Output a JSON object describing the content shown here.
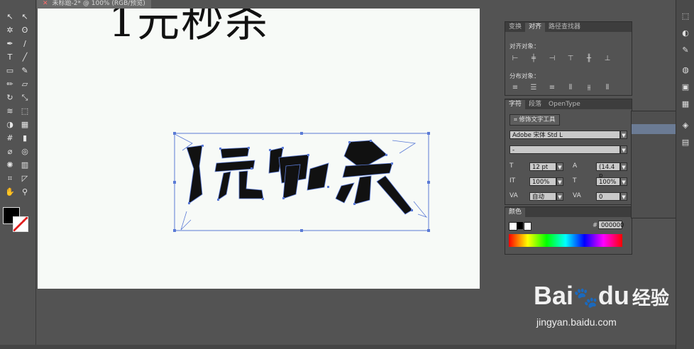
{
  "document": {
    "tab_title": "未标题-2* @ 100% (RGB/预览)",
    "close_glyph": "✕"
  },
  "artboard": {
    "heading_text": "1元秒杀",
    "logo_text": "1元秒杀"
  },
  "tools": [
    {
      "name": "selection-tool-icon",
      "glyph": "↖"
    },
    {
      "name": "direct-selection-tool-icon",
      "glyph": "↖"
    },
    {
      "name": "magic-wand-tool-icon",
      "glyph": "✲"
    },
    {
      "name": "lasso-tool-icon",
      "glyph": "ʘ"
    },
    {
      "name": "pen-tool-icon",
      "glyph": "✒"
    },
    {
      "name": "curvature-tool-icon",
      "glyph": "∕"
    },
    {
      "name": "type-tool-icon",
      "glyph": "T"
    },
    {
      "name": "line-tool-icon",
      "glyph": "╱"
    },
    {
      "name": "rectangle-tool-icon",
      "glyph": "▭"
    },
    {
      "name": "paintbrush-tool-icon",
      "glyph": "✎"
    },
    {
      "name": "pencil-tool-icon",
      "glyph": "✏"
    },
    {
      "name": "eraser-tool-icon",
      "glyph": "▱"
    },
    {
      "name": "rotate-tool-icon",
      "glyph": "↻"
    },
    {
      "name": "scale-tool-icon",
      "glyph": "⤡"
    },
    {
      "name": "warp-tool-icon",
      "glyph": "≋"
    },
    {
      "name": "free-transform-tool-icon",
      "glyph": "⬚"
    },
    {
      "name": "shape-builder-tool-icon",
      "glyph": "◑"
    },
    {
      "name": "perspective-grid-tool-icon",
      "glyph": "▦"
    },
    {
      "name": "mesh-tool-icon",
      "glyph": "#"
    },
    {
      "name": "gradient-tool-icon",
      "glyph": "▮"
    },
    {
      "name": "eyedropper-tool-icon",
      "glyph": "⌀"
    },
    {
      "name": "blend-tool-icon",
      "glyph": "◎"
    },
    {
      "name": "symbol-sprayer-tool-icon",
      "glyph": "✺"
    },
    {
      "name": "column-graph-tool-icon",
      "glyph": "▥"
    },
    {
      "name": "artboard-tool-icon",
      "glyph": "⌗"
    },
    {
      "name": "slice-tool-icon",
      "glyph": "◸"
    },
    {
      "name": "hand-tool-icon",
      "glyph": "✋"
    },
    {
      "name": "zoom-tool-icon",
      "glyph": "⚲"
    }
  ],
  "align_panel": {
    "tabs": [
      "变换",
      "对齐",
      "路径查找器"
    ],
    "active_tab": "对齐",
    "align_objects_label": "对齐对象：",
    "distribute_objects_label": "分布对象："
  },
  "character_panel": {
    "tabs": [
      "字符",
      "段落",
      "OpenType"
    ],
    "active_tab": "字符",
    "touch_type_button": "修饰文字工具",
    "font_family": "Adobe 宋体 Std L",
    "font_style": "-",
    "font_size": "12 pt",
    "leading": "(14.4 p",
    "vertical_scale": "100%",
    "horizontal_scale": "100%",
    "kerning": "自动",
    "tracking": "0"
  },
  "color_panel": {
    "tab": "颜色",
    "hex_label": "#",
    "hex_value": "000000"
  },
  "watermark": {
    "brand": "Bai",
    "brand2": "du",
    "suffix": "经验",
    "url": "jingyan.baidu.com"
  },
  "colors": {
    "accent": "#5b7bd6",
    "canvas": "#f7faf7",
    "ui_bg": "#535353"
  }
}
